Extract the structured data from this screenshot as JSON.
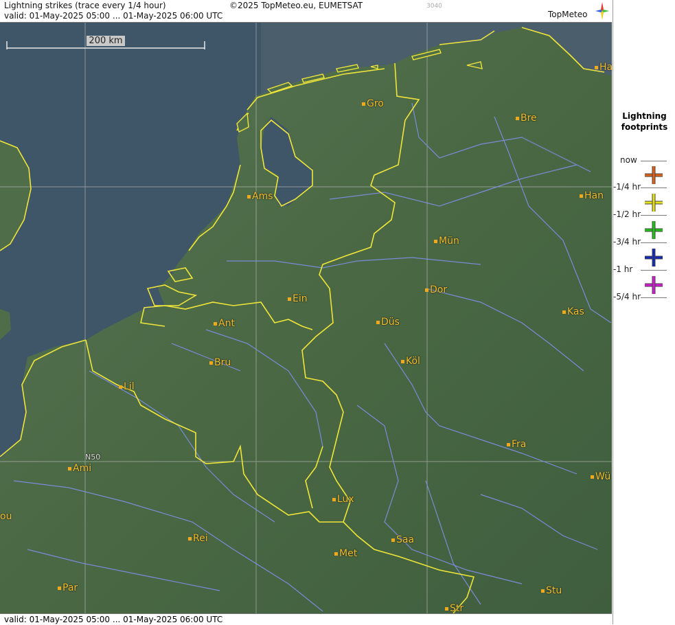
{
  "header": {
    "title": "Lightning strikes (trace every 1/4 hour)",
    "copyright": "©2025 TopMeteo.eu, EUMETSAT",
    "code": "3040",
    "valid": "valid:  01-May-2025 05:00 ... 01-May-2025 06:00 UTC",
    "logo": "TopMeteo"
  },
  "scale": {
    "label": "200 km"
  },
  "grid_label": "N50",
  "cities": [
    {
      "name": "Gro"
    },
    {
      "name": "Bre"
    },
    {
      "name": "Ha"
    },
    {
      "name": "Ams"
    },
    {
      "name": "Han"
    },
    {
      "name": "Mün"
    },
    {
      "name": "Ein"
    },
    {
      "name": "Dor"
    },
    {
      "name": "Ant"
    },
    {
      "name": "Düs"
    },
    {
      "name": "Kas"
    },
    {
      "name": "Bru"
    },
    {
      "name": "Köl"
    },
    {
      "name": "Lil"
    },
    {
      "name": "Fra"
    },
    {
      "name": "Ami"
    },
    {
      "name": "Wü"
    },
    {
      "name": "Lux"
    },
    {
      "name": "ou"
    },
    {
      "name": "Rei"
    },
    {
      "name": "Saa"
    },
    {
      "name": "Met"
    },
    {
      "name": "Par"
    },
    {
      "name": "Stu"
    },
    {
      "name": "Str"
    }
  ],
  "legend": {
    "title_line1": "Lightning",
    "title_line2": "footprints",
    "times": [
      "now",
      "-1/4 hr",
      "-1/2 hr",
      "-3/4 hr",
      "-1 hr",
      "-5/4 hr"
    ],
    "colors": [
      "#e0621a",
      "#e6e21a",
      "#22c21a",
      "#1428b8",
      "#d21ad2"
    ]
  },
  "footer": {
    "valid": "valid:  01-May-2025 05:00 ... 01-May-2025 06:00 UTC"
  },
  "colors": {
    "border": "#f0e63a",
    "river": "#7d8ee8",
    "sea": "#3e5567",
    "land": "#4d6a44"
  }
}
